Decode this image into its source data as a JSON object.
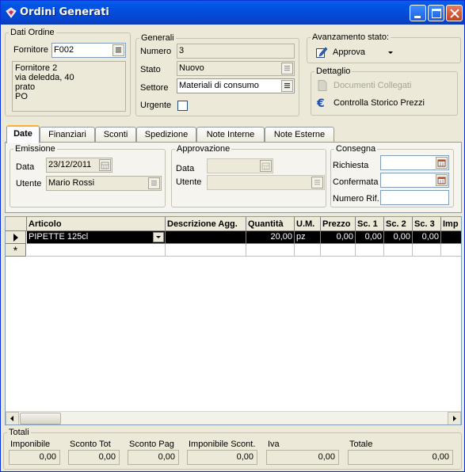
{
  "window": {
    "title": "Ordini Generati",
    "icon": "order-app-icon"
  },
  "dati_ordine": {
    "title": "Dati Ordine",
    "fornitore_label": "Fornitore",
    "fornitore_value": "F002",
    "address": "Fornitore 2\nvia deledda, 40\nprato\nPO"
  },
  "generali": {
    "title": "Generali",
    "numero_label": "Numero",
    "numero_value": "3",
    "stato_label": "Stato",
    "stato_value": "Nuovo",
    "settore_label": "Settore",
    "settore_value": "Materiali di consumo",
    "urgente_label": "Urgente"
  },
  "avanzamento": {
    "title": "Avanzamento stato:",
    "approva_label": "Approva"
  },
  "dettaglio": {
    "title": "Dettaglio",
    "documenti_label": "Documenti Collegati",
    "storico_label": "Controlla Storico Prezzi"
  },
  "tabs": [
    {
      "label": "Date"
    },
    {
      "label": "Finanziari"
    },
    {
      "label": "Sconti"
    },
    {
      "label": "Spedizione"
    },
    {
      "label": "Note Interne"
    },
    {
      "label": "Note Esterne"
    }
  ],
  "emissione": {
    "title": "Emissione",
    "data_label": "Data",
    "data_value": "23/12/2011",
    "utente_label": "Utente",
    "utente_value": "Mario Rossi"
  },
  "approvazione": {
    "title": "Approvazione",
    "data_label": "Data",
    "utente_label": "Utente"
  },
  "consegna": {
    "title": "Consegna",
    "richiesta_label": "Richiesta",
    "confermata_label": "Confermata",
    "numero_rif_label": "Numero Rif."
  },
  "grid": {
    "columns": [
      "Articolo",
      "Descrizione Agg.",
      "Quantità",
      "U.M.",
      "Prezzo",
      "Sc. 1",
      "Sc. 2",
      "Sc. 3",
      "Imp"
    ],
    "rows": [
      {
        "articolo": "PIPETTE 125cl",
        "descrizione": "",
        "quantita": "20,00",
        "um": "pz",
        "prezzo": "0,00",
        "sc1": "0,00",
        "sc2": "0,00",
        "sc3": "0,00",
        "imp": ""
      }
    ],
    "new_row_marker": "*"
  },
  "totali": {
    "title": "Totali",
    "imponibile_label": "Imponibile",
    "imponibile_value": "0,00",
    "sconto_tot_label": "Sconto Tot",
    "sconto_tot_value": "0,00",
    "sconto_pag_label": "Sconto Pag",
    "sconto_pag_value": "0,00",
    "imponibile_scont_label": "Imponibile Scont.",
    "imponibile_scont_value": "0,00",
    "iva_label": "Iva",
    "iva_value": "0,00",
    "totale_label": "Totale",
    "totale_value": "0,00"
  }
}
